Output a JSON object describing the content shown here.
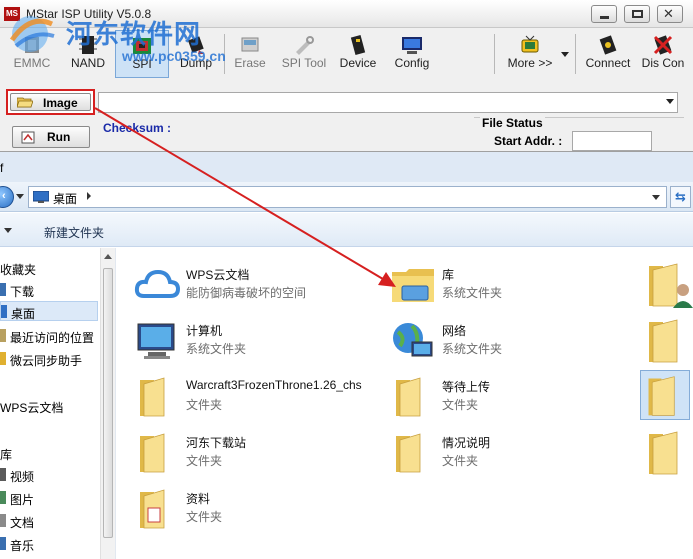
{
  "isp": {
    "title": "MStar ISP Utility V5.0.8",
    "logo_text": "MS",
    "toolbar": [
      {
        "id": "emmc",
        "label": "EMMC",
        "icon": "emmc-chip-icon",
        "state": "dim"
      },
      {
        "id": "nand",
        "label": "NAND",
        "icon": "nand-chip-icon",
        "state": "normal"
      },
      {
        "id": "spi",
        "label": "SPI",
        "icon": "spi-chip-icon",
        "state": "selected"
      },
      {
        "id": "dump",
        "label": "Dump",
        "icon": "dump-chip-icon",
        "state": "normal"
      },
      {
        "id": "erase",
        "label": "Erase",
        "icon": "erase-icon",
        "state": "dim"
      },
      {
        "id": "spitool",
        "label": "SPI Tool",
        "icon": "spi-tool-icon",
        "state": "dim"
      },
      {
        "id": "device",
        "label": "Device",
        "icon": "device-chip-icon",
        "state": "normal"
      },
      {
        "id": "config",
        "label": "Config",
        "icon": "config-icon",
        "state": "normal"
      },
      {
        "id": "more",
        "label": "More >>",
        "icon": "tv-icon",
        "state": "normal"
      },
      {
        "id": "connect",
        "label": "Connect",
        "icon": "connect-icon",
        "state": "normal"
      },
      {
        "id": "discon",
        "label": "Dis Con",
        "icon": "disconnect-icon",
        "state": "normal"
      }
    ],
    "image_button_label": "Image",
    "run_button_label": "Run",
    "checksum_label": "Checksum :",
    "file_status_title": "File Status",
    "start_addr_label": "Start Addr. :",
    "colors": {
      "highlight_border": "#d62020",
      "checksum_text": "#1a2aa8",
      "arrow": "#d62020"
    }
  },
  "watermark": {
    "text": "河东软件网",
    "url": "www.pc0359.cn"
  },
  "explorer": {
    "title_fragment": "f",
    "address": {
      "location": "桌面"
    },
    "commands": {
      "new_folder": "新建文件夹"
    },
    "nav": {
      "items": [
        {
          "label": "收藏夹",
          "icon": "favorites-icon",
          "type": "head"
        },
        {
          "label": "下载",
          "icon": "downloads-icon",
          "type": "item"
        },
        {
          "label": "桌面",
          "icon": "desktop-icon",
          "type": "item",
          "selected": true
        },
        {
          "label": "最近访问的位置",
          "icon": "recent-places-icon",
          "type": "item"
        },
        {
          "label": "微云同步助手",
          "icon": "weiyun-icon",
          "type": "item"
        },
        {
          "label": "WPS云文档",
          "icon": "wps-cloud-icon",
          "type": "head"
        },
        {
          "label": "库",
          "icon": "library-icon",
          "type": "head"
        },
        {
          "label": "视频",
          "icon": "video-icon",
          "type": "item"
        },
        {
          "label": "图片",
          "icon": "pictures-icon",
          "type": "item"
        },
        {
          "label": "文档",
          "icon": "documents-icon",
          "type": "item"
        },
        {
          "label": "音乐",
          "icon": "music-icon",
          "type": "item"
        }
      ]
    },
    "files": [
      {
        "name": "WPS云文档",
        "desc": "能防御病毒破坏的空间",
        "icon": "cloud-icon"
      },
      {
        "name": "库",
        "desc": "系统文件夹",
        "icon": "library-folder-icon"
      },
      {
        "name": "计算机",
        "desc": "系统文件夹",
        "icon": "computer-icon"
      },
      {
        "name": "网络",
        "desc": "系统文件夹",
        "icon": "network-icon"
      },
      {
        "name": "Warcraft3FrozenThrone1.26_chs",
        "desc": "文件夹",
        "icon": "folder-icon"
      },
      {
        "name": "等待上传",
        "desc": "文件夹",
        "icon": "folder-icon"
      },
      {
        "name": "河东下载站",
        "desc": "文件夹",
        "icon": "folder-icon"
      },
      {
        "name": "情况说明",
        "desc": "文件夹",
        "icon": "folder-icon"
      },
      {
        "name": "资料",
        "desc": "文件夹",
        "icon": "folder-icon"
      }
    ]
  }
}
